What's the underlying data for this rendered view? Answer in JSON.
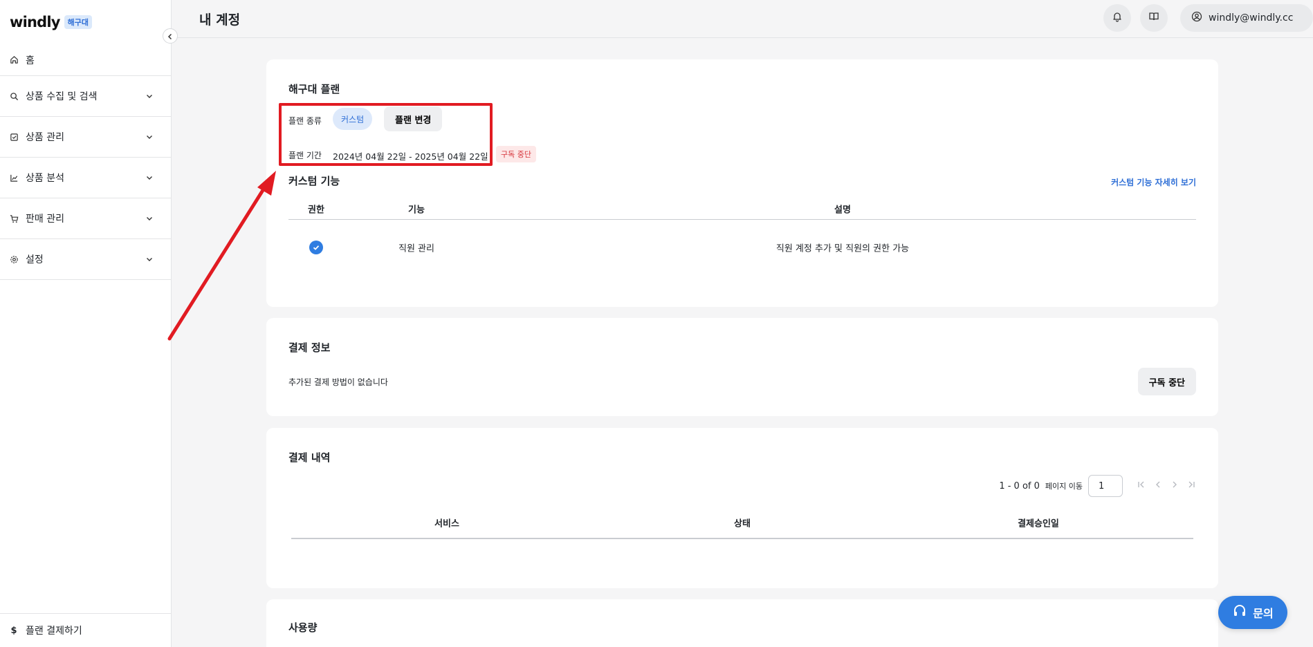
{
  "sidebar": {
    "logo": "windly",
    "badge": "해구대",
    "home": "홈",
    "items": [
      {
        "label": "상품 수집 및 검색",
        "icon": "search-icon"
      },
      {
        "label": "상품 관리",
        "icon": "checkbox-icon"
      },
      {
        "label": "상품 분석",
        "icon": "chart-icon"
      },
      {
        "label": "판매 관리",
        "icon": "cart-icon"
      },
      {
        "label": "설정",
        "icon": "gear-icon"
      }
    ],
    "footer": "플랜 결제하기"
  },
  "header": {
    "title": "내 계정",
    "user_email": "windly@windly.cc"
  },
  "plan": {
    "title": "해구대 플랜",
    "type_label": "플랜 종류",
    "type_value": "커스텀",
    "change_button": "플랜 변경",
    "period_label": "플랜 기간",
    "period_value": "2024년 04월 22일 - 2025년 04월 22일",
    "status_badge": "구독 중단",
    "custom_features_title": "커스텀 기능",
    "custom_features_link": "커스텀 기능 자세히 보기",
    "table": {
      "headers": [
        "권한",
        "기능",
        "설명"
      ],
      "rows": [
        {
          "feature": "직원 관리",
          "description": "직원 계정 추가 및 직원의 권한 가능"
        }
      ]
    }
  },
  "payment_info": {
    "title": "결제 정보",
    "empty_text": "추가된 결제 방법이 없습니다",
    "stop_button": "구독 중단"
  },
  "payment_history": {
    "title": "결제 내역",
    "range": "1 - 0 of 0",
    "goto_label": "페이지 이동",
    "page_value": "1",
    "headers": [
      "서비스",
      "상태",
      "결제승인일"
    ]
  },
  "usage": {
    "title": "사용량"
  },
  "fab": {
    "label": "문의"
  },
  "colors": {
    "accent": "#2f7de1",
    "highlight": "#e11b22"
  }
}
